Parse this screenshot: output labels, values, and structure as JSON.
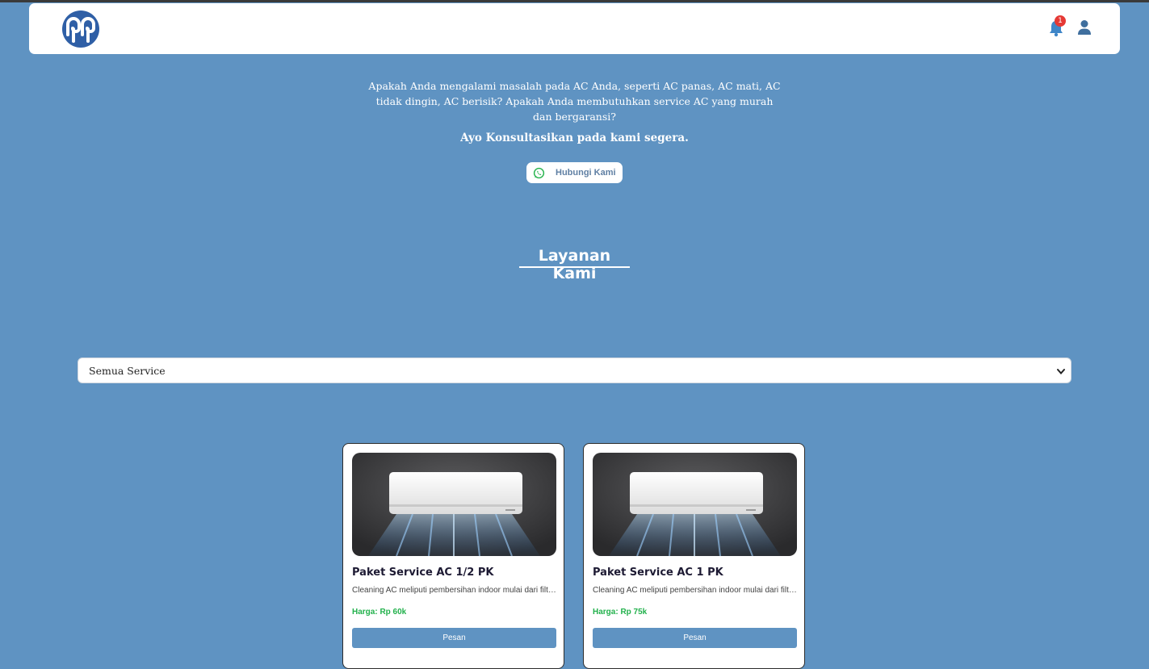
{
  "navbar": {
    "logo_icon": "brand-logo",
    "notification_count": "1",
    "bell_icon": "bell-icon",
    "user_icon": "user-icon"
  },
  "hero": {
    "text": "Apakah Anda mengalami masalah pada AC Anda, seperti AC panas, AC mati, AC tidak dingin, AC berisik? Apakah Anda membutuhkan service AC yang murah dan bergaransi?",
    "cta": "Ayo Konsultasikan pada kami segera.",
    "contact_button": "Hubungi Kami",
    "contact_icon": "whatsapp-icon"
  },
  "section": {
    "title": "Layanan Kami"
  },
  "filter": {
    "selected": "Semua Service"
  },
  "cards": [
    {
      "title": "Paket Service AC 1/2 PK",
      "description": "Cleaning AC meliputi pembersihan indoor mulai dari filter, evaporator dan blower",
      "price": "Harga: Rp 60k",
      "button": "Pesan"
    },
    {
      "title": "Paket Service AC 1 PK",
      "description": "Cleaning AC meliputi pembersihan indoor mulai dari filter, evaporator dan blower",
      "price": "Harga: Rp 75k",
      "button": "Pesan"
    }
  ],
  "colors": {
    "background": "#5f93c2",
    "price": "#22b14c",
    "badge": "#e53935"
  }
}
